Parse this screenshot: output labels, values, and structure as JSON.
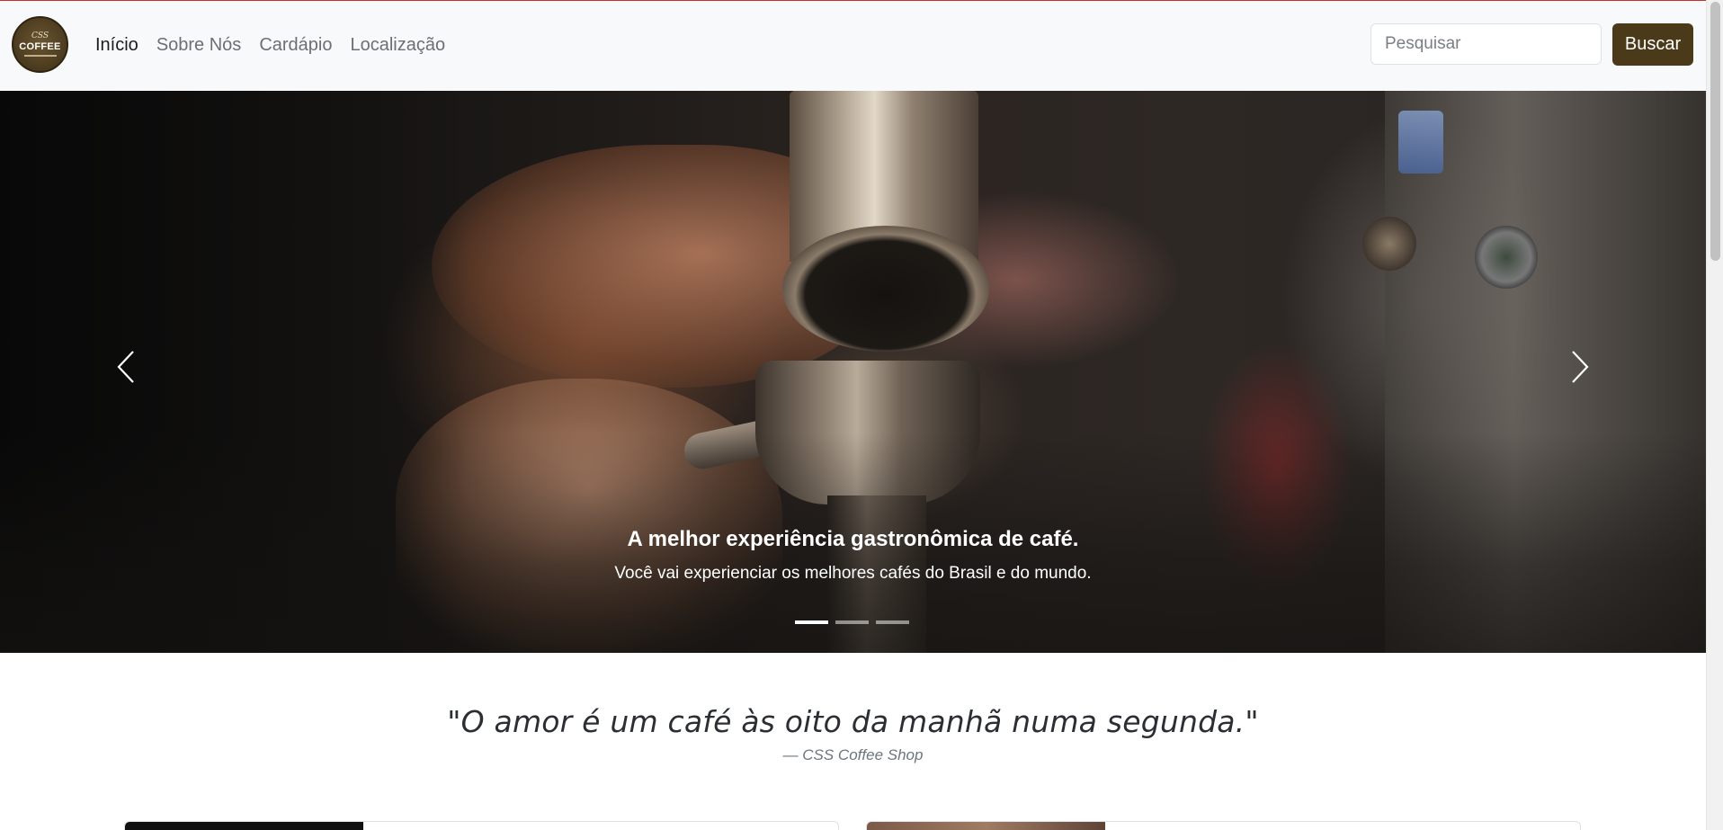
{
  "navbar": {
    "logo_text": "COFFEE",
    "logo_small": "CSS",
    "links": [
      {
        "label": "Início",
        "active": true
      },
      {
        "label": "Sobre Nós",
        "active": false
      },
      {
        "label": "Cardápio",
        "active": false
      },
      {
        "label": "Localização",
        "active": false
      }
    ],
    "search": {
      "placeholder": "Pesquisar",
      "value": ""
    },
    "search_button": "Buscar"
  },
  "carousel": {
    "title": "A melhor experiência gastronômica de café.",
    "text": "Você vai experienciar os melhores cafés do Brasil e do mundo.",
    "indicators_count": 3,
    "active_indicator": 0,
    "prev_icon": "chevron-left-icon",
    "next_icon": "chevron-right-icon"
  },
  "quote": {
    "text": "\"O amor é um café às oito da manhã numa segunda.\"",
    "author": "— CSS Coffee Shop"
  },
  "colors": {
    "brand": "#4a3a1a",
    "navbar_bg": "#f8f9fa",
    "accent_line": "#c9302c"
  }
}
